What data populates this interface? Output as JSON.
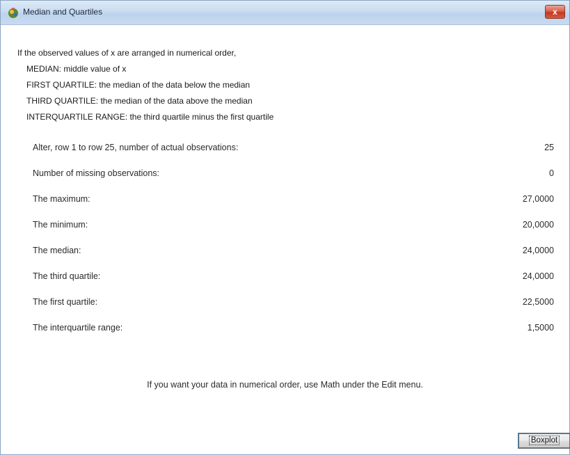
{
  "window": {
    "title": "Median and Quartiles",
    "close_glyph": "x"
  },
  "intro": {
    "heading": "If the observed values of x are arranged in numerical order,",
    "definitions": [
      "MEDIAN:  middle value of x",
      "FIRST QUARTILE:  the median of the data below the median",
      "THIRD QUARTILE:  the median of the data above the median",
      "INTERQUARTILE RANGE:  the third quartile minus the first quartile"
    ]
  },
  "stats": [
    {
      "label": "Alter, row 1 to row 25, number of actual observations:",
      "value": "25"
    },
    {
      "label": "Number of missing observations:",
      "value": "0"
    },
    {
      "label": "The maximum:",
      "value": "27,0000"
    },
    {
      "label": "The minimum:",
      "value": "20,0000"
    },
    {
      "label": "The median:",
      "value": "24,0000"
    },
    {
      "label": "The third quartile:",
      "value": "24,0000"
    },
    {
      "label": "The first quartile:",
      "value": "22,5000"
    },
    {
      "label": "The interquartile range:",
      "value": "1,5000"
    }
  ],
  "note": "If you want your data in numerical order, use Math under the Edit menu.",
  "buttons": {
    "boxplot": "Boxplot"
  }
}
